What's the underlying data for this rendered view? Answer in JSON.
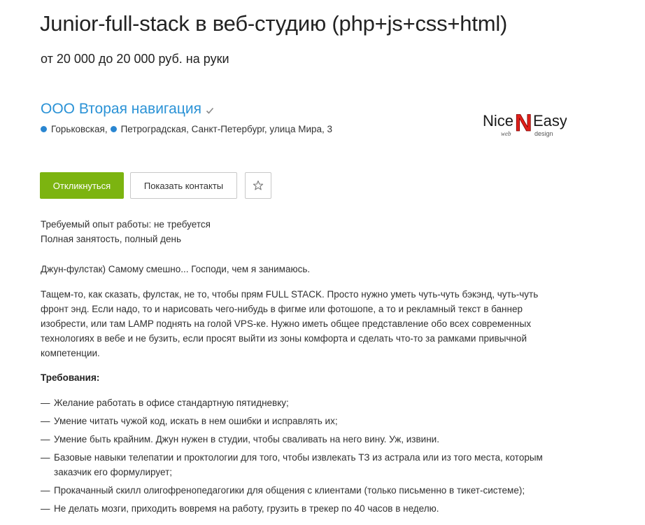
{
  "vacancy": {
    "title": "Junior-full-stack в веб-студию (php+js+css+html)",
    "salary": "от 20 000 до 20 000 руб. на руки"
  },
  "company": {
    "name": "ООО Вторая навигация",
    "metro": [
      "Горьковская,",
      "Петроградская, Санкт-Петербург, улица Мира, 3"
    ],
    "metro_color": "#2a86d1",
    "logo": {
      "text_left": "Nice",
      "text_mid": "N",
      "text_right": "Easy",
      "sub_left": "web",
      "sub_right": "design"
    }
  },
  "actions": {
    "respond_label": "Откликнуться",
    "contacts_label": "Показать контакты",
    "favorite_icon": "star-icon",
    "accent": "#7cb410"
  },
  "meta": {
    "experience": "Требуемый опыт работы: не требуется",
    "employment": "Полная занятость, полный день"
  },
  "description": {
    "intro": "Джун-фулстак) Самому смешно... Господи, чем я занимаюсь.",
    "body": "Тащем-то, как сказать, фулстак, не то, чтобы прям FULL STACK. Просто нужно уметь чуть-чуть бэкэнд, чуть-чуть фронт энд. Если надо, то и нарисовать чего-нибудь в фигме или фотошопе, а то и рекламный текст в баннер изобрести, или там LAMP поднять на голой VPS-ке. Нужно иметь общее представление обо всех современных технологиях в вебе и не бузить, если просят выйти из зоны комфорта и сделать что-то за рамками привычной компетенции."
  },
  "requirements": {
    "title": "Требования:",
    "dash": "—",
    "items": [
      "Желание работать в офисе стандартную пятидневку;",
      "Умение читать чужой код, искать в нем ошибки и исправлять их;",
      "Умение быть крайним. Джун нужен в студии, чтобы сваливать на него вину. Уж, извини.",
      "Базовые навыки телепатии и проктологии для того, чтобы извлекать ТЗ из астрала или из того места, которым заказчик его формулирует;",
      "Прокачанный скилл олигофренопедагогики для общения с клиентами (только письменно в тикет-системе);",
      "Не делать мозги, приходить вовремя на работу, грузить в трекер по 40 часов в неделю."
    ]
  }
}
